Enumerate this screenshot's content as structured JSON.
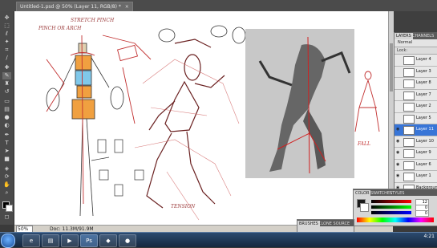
{
  "document": {
    "tab_title": "Untitled-1.psd @ 50% (Layer 11, RGB/8) *",
    "tab_close": "×",
    "zoom": "50%",
    "doc_info": "Doc: 11.3M/91.9M"
  },
  "canvas_notes": {
    "pinch_or_arch": "PINCH OR ARCH",
    "stretch_pinch": "STRETCH PINCH",
    "tension": "TENSION",
    "fall": "FALL"
  },
  "layers_panel": {
    "tabs": [
      "LAYERS",
      "CHANNELS",
      "PATHS"
    ],
    "blend_mode": "Normal",
    "lock_label": "Lock:",
    "layers": [
      {
        "name": "Layer 4",
        "visible": false,
        "selected": false
      },
      {
        "name": "Layer 3",
        "visible": false,
        "selected": false
      },
      {
        "name": "Layer 8",
        "visible": false,
        "selected": false
      },
      {
        "name": "Layer 7",
        "visible": false,
        "selected": false
      },
      {
        "name": "Layer 2",
        "visible": false,
        "selected": false
      },
      {
        "name": "Layer 5",
        "visible": false,
        "selected": false
      },
      {
        "name": "Layer 11",
        "visible": true,
        "selected": true
      },
      {
        "name": "Layer 10",
        "visible": true,
        "selected": false
      },
      {
        "name": "Layer 9",
        "visible": true,
        "selected": false
      },
      {
        "name": "Layer 6",
        "visible": true,
        "selected": false
      },
      {
        "name": "Layer 1",
        "visible": true,
        "selected": false
      },
      {
        "name": "Background",
        "visible": true,
        "selected": false
      }
    ]
  },
  "color_panel": {
    "tabs": [
      "COLOR",
      "SWATCHES",
      "STYLES"
    ],
    "values": [
      "12",
      "0",
      "0"
    ],
    "accent": "#cc2020"
  },
  "brushes_panel": {
    "tabs": [
      "BRUSHES",
      "CLONE SOURCE"
    ]
  },
  "taskbar": {
    "apps": [
      "ie",
      "folder",
      "media",
      "ps",
      "app5",
      "app6"
    ],
    "time": "4:21"
  }
}
